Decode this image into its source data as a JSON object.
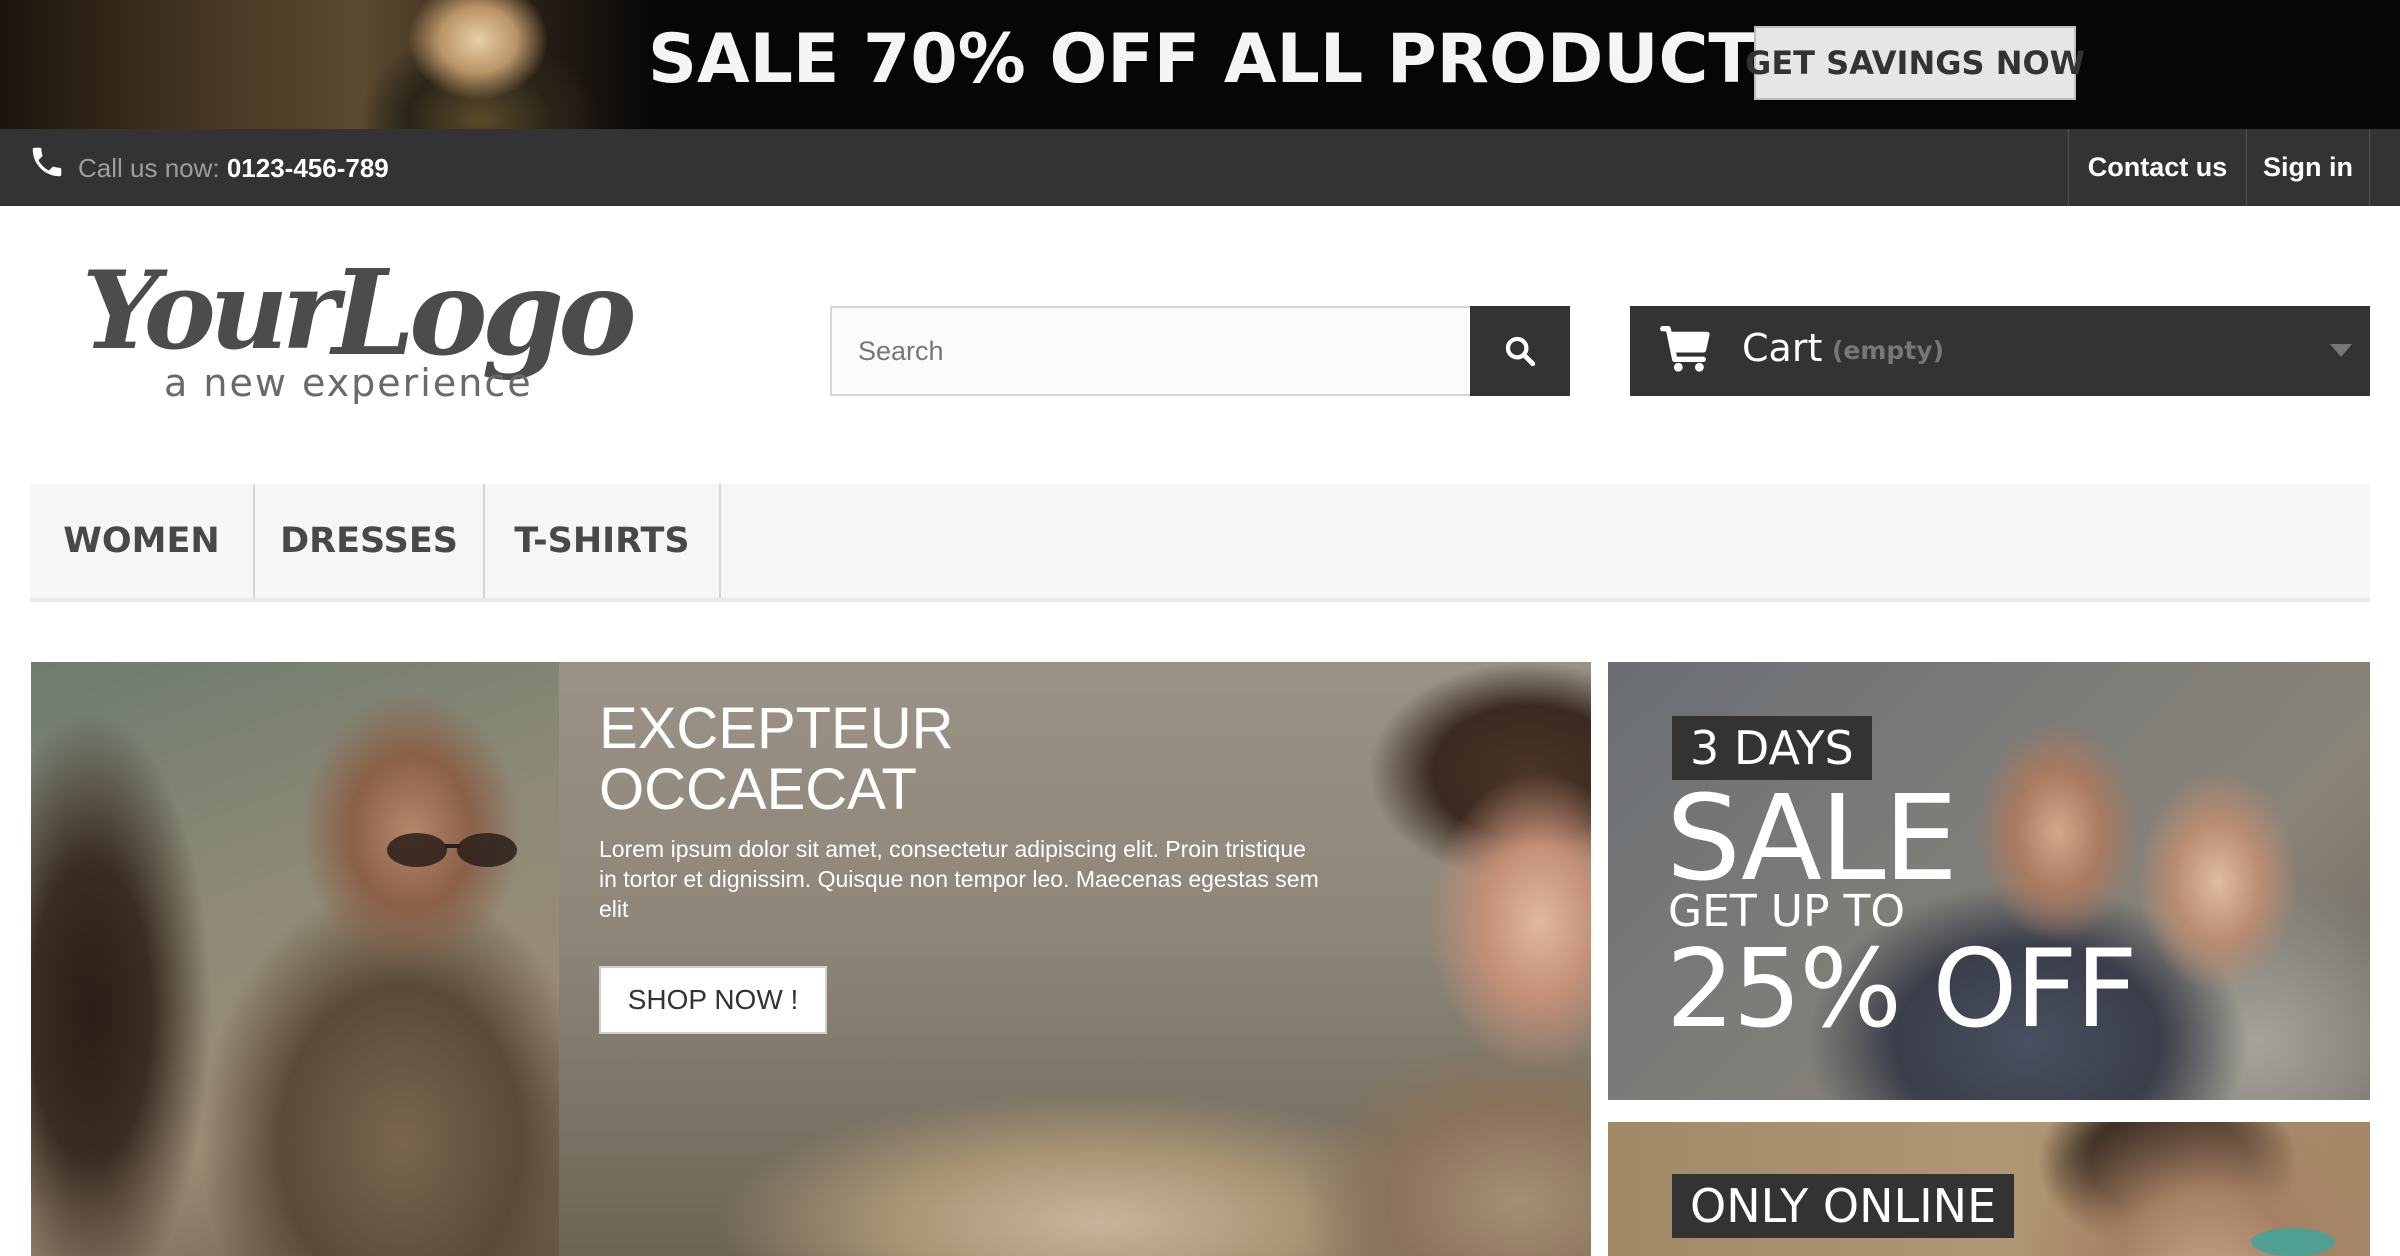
{
  "banner": {
    "headline": "SALE 70% OFF ALL PRODUCTS",
    "cta_label": "GET SAVINGS NOW"
  },
  "top_nav": {
    "call_label": "Call us now: ",
    "phone_number": "0123-456-789",
    "contact_label": "Contact us",
    "signin_label": "Sign in"
  },
  "header": {
    "logo_icon": "your-logo-a-new-experience",
    "search": {
      "placeholder": "Search",
      "value": ""
    },
    "cart": {
      "label": "Cart",
      "status": "(empty)"
    }
  },
  "menu": {
    "items": [
      {
        "label": "WOMEN"
      },
      {
        "label": "DRESSES"
      },
      {
        "label": "T-SHIRTS"
      }
    ]
  },
  "slider": {
    "title": "EXCEPTEUR OCCAECAT",
    "text": "Lorem ipsum dolor sit amet, consectetur adipiscing elit. Proin tristique in tortor et dignissim. Quisque non tempor leo. Maecenas egestas sem elit",
    "button_label": "SHOP NOW !"
  },
  "promos": {
    "sale": {
      "days_label": "3 DAYS",
      "sale_word": "SALE",
      "get_up_to": "GET UP TO",
      "discount": "25% OFF"
    },
    "online": {
      "label": "ONLY ONLINE"
    }
  },
  "colors": {
    "dark": "#333333",
    "banner_bg": "#060606",
    "menu_bg": "#f6f6f6",
    "muted_text": "#777777"
  }
}
